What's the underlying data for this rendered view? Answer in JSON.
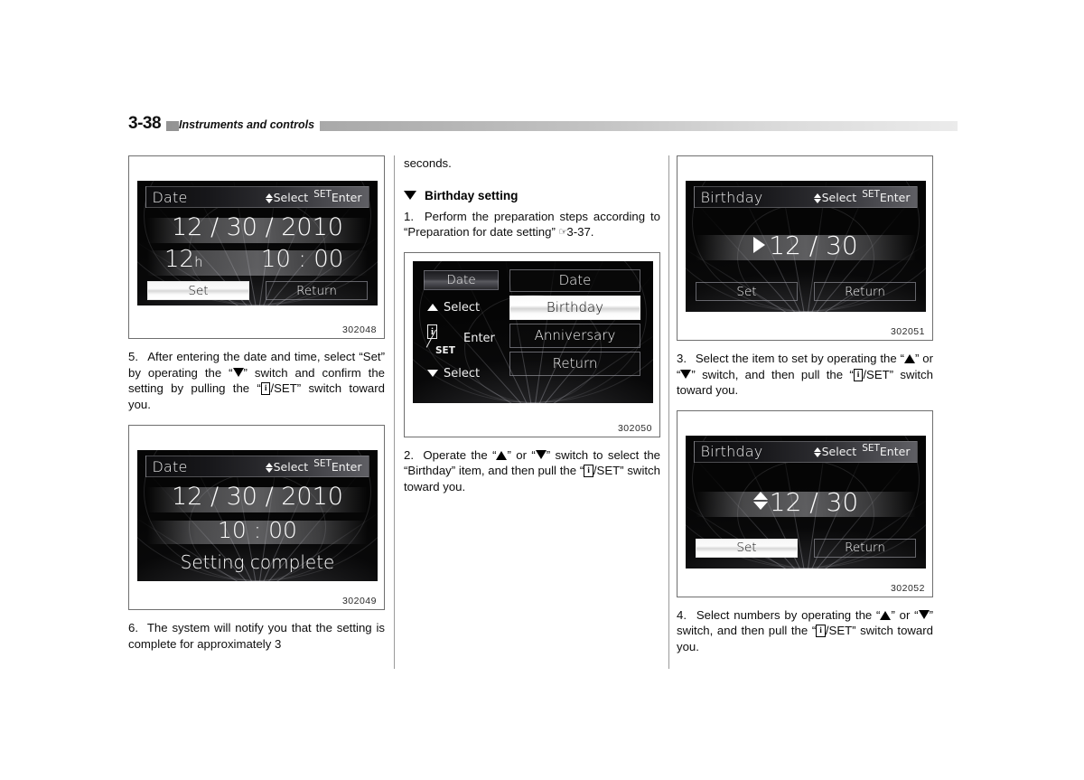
{
  "header": {
    "page_number": "3-38",
    "title": "Instruments and controls"
  },
  "left_column": {
    "figure1": {
      "caption": "302048",
      "screen": {
        "title": "Date",
        "select_label": "Select",
        "set_label": "SET",
        "enter_label": "Enter",
        "date_value": "12 / 30 / 2010",
        "hour_mode": "12",
        "hour_unit": "h",
        "time_value": "10 : 00",
        "button_set": "Set",
        "button_return": "Return"
      }
    },
    "step5": {
      "number": "5.",
      "text_a": "After entering the date and time, select “Set” by operating the “",
      "text_b": "” switch and confirm the setting by pulling the “",
      "icon_label": "i",
      "text_c": "/SET” switch toward you."
    },
    "figure2": {
      "caption": "302049",
      "screen": {
        "title": "Date",
        "select_label": "Select",
        "set_label": "SET",
        "enter_label": "Enter",
        "date_value": "12 / 30 / 2010",
        "time_value": "10 : 00",
        "message": "Setting complete"
      }
    },
    "step6": {
      "number": "6.",
      "text": "The system will notify you that the setting is complete for approximately 3"
    }
  },
  "middle_column": {
    "continuation": "seconds.",
    "section_heading": "Birthday setting",
    "step1": {
      "number": "1.",
      "text_a": "Perform the preparation steps according to “Preparation for date setting” ",
      "hand_icon": "☞",
      "reference": "3-37."
    },
    "figure3": {
      "caption": "302050",
      "screen": {
        "panel_title": "Date",
        "select_up_label": "Select",
        "select_down_label": "Select",
        "enter_label": "Enter",
        "icon_label": "i",
        "set_label": "SET",
        "menu_items": [
          {
            "label": "Date",
            "selected": false
          },
          {
            "label": "Birthday",
            "selected": true
          },
          {
            "label": "Anniversary",
            "selected": false
          },
          {
            "label": "Return",
            "selected": false
          }
        ]
      }
    },
    "step2": {
      "number": "2.",
      "text_a": "Operate the “",
      "text_b": "” or “",
      "text_c": "” switch to select the “Birthday” item, and then pull the “",
      "icon_label": "i",
      "text_d": "/SET” switch toward you."
    }
  },
  "right_column": {
    "figure4": {
      "caption": "302051",
      "screen": {
        "title": "Birthday",
        "select_label": "Select",
        "set_label": "SET",
        "enter_label": "Enter",
        "value": "12 / 30",
        "cursor_icon": "right-triangle",
        "button_set": "Set",
        "button_return": "Return"
      }
    },
    "step3": {
      "number": "3.",
      "text_a": "Select the item to set by operating the “",
      "text_b": "” or “",
      "text_c": "” switch, and then pull the “",
      "icon_label": "i",
      "text_d": "/SET” switch toward you."
    },
    "figure5": {
      "caption": "302052",
      "screen": {
        "title": "Birthday",
        "select_label": "Select",
        "set_label": "SET",
        "enter_label": "Enter",
        "value": "12 / 30",
        "cursor_icon": "up-down-triangle",
        "button_set": "Set",
        "button_return": "Return"
      }
    },
    "step4": {
      "number": "4.",
      "text_a": "Select numbers by operating the “",
      "text_b": "” or “",
      "text_c": "” switch, and then pull the “",
      "icon_label": "i",
      "text_d": "/SET” switch toward you."
    }
  },
  "colors": {
    "page_background": "#ffffff",
    "text": "#0d0d0d",
    "rule": "#9a9a9a",
    "lcd_background": "#050505",
    "lcd_text": "#f4f4f4",
    "highlight": "#ffffff"
  }
}
